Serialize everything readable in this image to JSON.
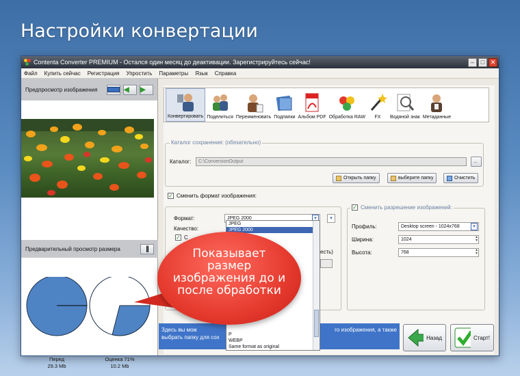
{
  "banner": {
    "title": "Настройки конвертации"
  },
  "window": {
    "title": "Contenta Converter PREMIUM - Остался один месяц до деактивации. Зарегистрируйтесь сейчас!"
  },
  "menu": [
    "Файл",
    "Купить сейчас",
    "Регистрация",
    "Упростить",
    "Параметры",
    "Язык",
    "Справка"
  ],
  "left": {
    "preview_label": "Предпросмотр изображения",
    "size_preview_label": "Предварительный просмотр размера",
    "before": {
      "label": "Перед",
      "value": "29.3 Mb"
    },
    "after": {
      "label": "Оценка 71%",
      "value": "10.2 Mb",
      "percent": 71
    }
  },
  "toolbar": {
    "items": [
      "Конвертировать",
      "Поделиться",
      "Переименовать",
      "Подпапки",
      "Альбом PDF",
      "Обработка RAW",
      "FX",
      "Водяной знак",
      "Метаданные"
    ]
  },
  "save": {
    "group_label": "Каталог сохранения: (обязательно)",
    "catalog_label": "Каталог:",
    "catalog_value": "C:\\ConversionOutput",
    "browse": "...",
    "open_folder": "Открыть папку",
    "choose_folder": "выберите папку",
    "clear": "Очистить"
  },
  "format": {
    "change_label": "Сменить формат изображения:",
    "format_label": "Формат:",
    "format_value": "JPEG 2000",
    "quality_label": "Качество:",
    "check_label": "С",
    "options_visible": [
      "JPEG",
      "JPEG 2000"
    ],
    "options_bottom": [
      "P",
      "WEBP",
      "Same format as original"
    ],
    "partial_text": "есть)"
  },
  "resolution": {
    "change_label": "Сменить разрешение изображений:",
    "profile_label": "Профиль:",
    "profile_value": "Desktop screen - 1024x768",
    "width_label": "Ширина:",
    "width_value": "1024",
    "height_label": "Высота:",
    "height_value": "768"
  },
  "hint": {
    "line1": "Здесь вы мож",
    "line1_end": "го изображения, а также",
    "line2": "выбрать папку для сох"
  },
  "nav": {
    "back": "Назад",
    "start": "Старт!"
  },
  "callout": {
    "text": "Показывает размер изображения до и после обработки"
  },
  "colors": {
    "accent": "#3f74c8",
    "callout": "#e53a2e",
    "pie": "#4f84c4"
  }
}
